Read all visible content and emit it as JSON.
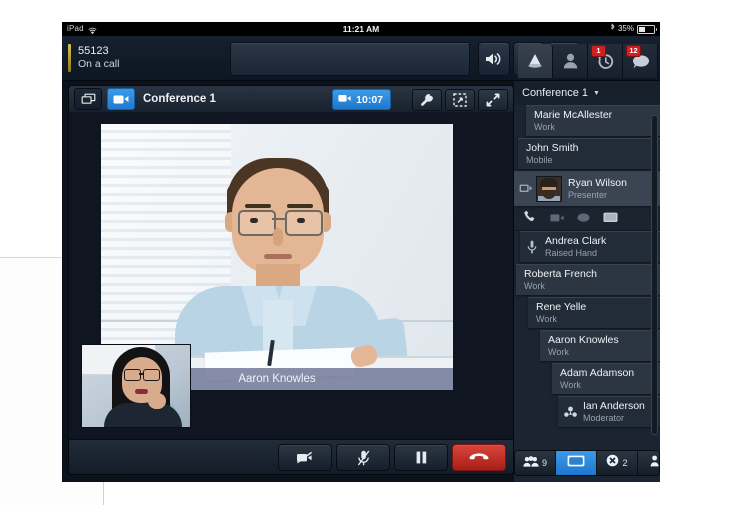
{
  "status_bar": {
    "device": "iPad",
    "wifi_icon": "wifi-icon",
    "time": "11:21 AM",
    "battery_percent": "35%",
    "bluetooth_icon": "bluetooth-icon"
  },
  "app_bar": {
    "call_number": "55123",
    "call_status": "On a call",
    "dial_field_placeholder": "",
    "buttons": [
      {
        "name": "speaker-button",
        "icon": "speaker-icon"
      },
      {
        "name": "settings-button",
        "icon": "gear-icon"
      },
      {
        "name": "voicemail-button",
        "icon": "voicemail-icon"
      }
    ],
    "tabs": [
      {
        "name": "tab-conference",
        "icon": "conference-icon",
        "badge": "",
        "active": true
      },
      {
        "name": "tab-contacts",
        "icon": "person-icon",
        "badge": "",
        "active": false
      },
      {
        "name": "tab-history",
        "icon": "history-clock-icon",
        "badge": "1",
        "active": false
      },
      {
        "name": "tab-messages",
        "icon": "chat-bubble-icon",
        "badge": "12",
        "active": false
      }
    ]
  },
  "video_panel": {
    "layout_button_icon": "layout-icon",
    "camera_button_icon": "video-camera-icon",
    "title": "Conference 1",
    "timer": "10:07",
    "timer_icon": "video-camera-icon",
    "tools": [
      {
        "name": "settings-wrench-button",
        "icon": "wrench-icon"
      },
      {
        "name": "crop-region-button",
        "icon": "crop-icon"
      },
      {
        "name": "fullscreen-button",
        "icon": "expand-arrows-icon"
      }
    ],
    "active_speaker_name": "Aaron Knowles",
    "self_view_label": "self-view",
    "controls": [
      {
        "name": "stop-video-button",
        "icon": "video-off-icon"
      },
      {
        "name": "mute-microphone-button",
        "icon": "mic-off-icon"
      },
      {
        "name": "hold-call-button",
        "icon": "pause-icon"
      },
      {
        "name": "end-call-button",
        "icon": "hangup-icon"
      }
    ]
  },
  "participants_panel": {
    "header": "Conference 1",
    "header_caret": "▼",
    "participants": [
      {
        "name": "Marie McAllester",
        "sub": "Work",
        "icon": "",
        "style": "light",
        "indent": 12
      },
      {
        "name": "John Smith",
        "sub": "Mobile",
        "icon": "",
        "style": "dark",
        "indent": 4
      },
      {
        "name": "Ryan Wilson",
        "sub": "Presenter",
        "icon": "screen-share-icon",
        "style": "selected",
        "indent": 0,
        "avatar": true
      },
      {
        "name": "Andrea Clark",
        "sub": "Raised Hand",
        "icon": "raised-hand-icon",
        "style": "dark",
        "indent": 6
      },
      {
        "name": "Roberta French",
        "sub": "Work",
        "icon": "",
        "style": "light",
        "indent": 2
      },
      {
        "name": "Rene Yelle",
        "sub": "Work",
        "icon": "",
        "style": "dark",
        "indent": 14
      },
      {
        "name": "Aaron Knowles",
        "sub": "Work",
        "icon": "",
        "style": "light",
        "indent": 26
      },
      {
        "name": "Adam Adamson",
        "sub": "Work",
        "icon": "",
        "style": "light",
        "indent": 38
      },
      {
        "name": "Ian Anderson",
        "sub": "Moderator",
        "icon": "moderator-icon",
        "style": "dark",
        "indent": 44
      }
    ],
    "row_actions": [
      {
        "name": "call-participant-button",
        "icon": "phone-icon"
      },
      {
        "name": "video-participant-button",
        "icon": "video-camera-icon"
      },
      {
        "name": "chat-participant-button",
        "icon": "chat-bubble-icon"
      },
      {
        "name": "share-screen-button",
        "icon": "screen-icon"
      }
    ],
    "footer": [
      {
        "name": "participant-count-button",
        "icon": "people-icon",
        "count": "9"
      },
      {
        "name": "video-layout-button",
        "icon": "screen-icon",
        "count": "",
        "active": true
      },
      {
        "name": "declined-count-button",
        "icon": "blocked-icon",
        "count": "2"
      },
      {
        "name": "speaking-participant-button",
        "icon": "person-speaking-icon",
        "count": ""
      }
    ]
  },
  "colors": {
    "accent_blue": "#2f8fe0",
    "badge_red": "#d01f1f",
    "hangup_red": "#c4332a",
    "panel_dark": "#1b2430",
    "row_light": "#2c3542",
    "amber": "#d8c250"
  }
}
